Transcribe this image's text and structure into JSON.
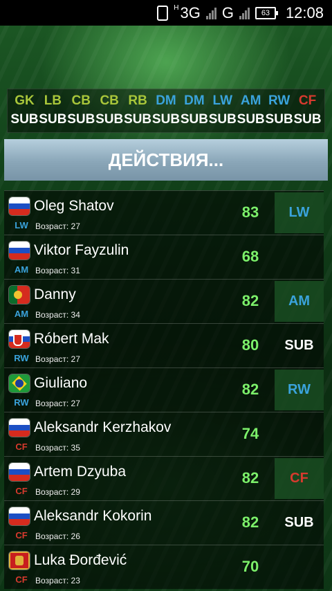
{
  "status_bar": {
    "network_primary": "3G",
    "network_primary_prefix": "H",
    "network_secondary": "G",
    "battery": "63",
    "time": "12:08"
  },
  "positions": [
    {
      "code": "GK",
      "slot": "SUB",
      "color": "#a9c63a"
    },
    {
      "code": "LB",
      "slot": "SUB",
      "color": "#a9c63a"
    },
    {
      "code": "CB",
      "slot": "SUB",
      "color": "#a9c63a"
    },
    {
      "code": "CB",
      "slot": "SUB",
      "color": "#a9c63a"
    },
    {
      "code": "RB",
      "slot": "SUB",
      "color": "#a9c63a"
    },
    {
      "code": "DM",
      "slot": "SUB",
      "color": "#3aa3dc"
    },
    {
      "code": "DM",
      "slot": "SUB",
      "color": "#3aa3dc"
    },
    {
      "code": "LW",
      "slot": "SUB",
      "color": "#3aa3dc"
    },
    {
      "code": "AM",
      "slot": "SUB",
      "color": "#3aa3dc"
    },
    {
      "code": "RW",
      "slot": "SUB",
      "color": "#3aa3dc"
    },
    {
      "code": "CF",
      "slot": "SUB",
      "color": "#d83a2e"
    }
  ],
  "actions_label": "ДЕЙСТВИЯ...",
  "players": [
    {
      "name": "Oleg Shatov",
      "position": "LW",
      "age_text": "Возраст: 27",
      "rating": "83",
      "slot": "LW",
      "flag": "russia-flag-icon"
    },
    {
      "name": "Viktor Fayzulin",
      "position": "AM",
      "age_text": "Возраст: 31",
      "rating": "68",
      "slot": "",
      "flag": "russia-flag-icon"
    },
    {
      "name": "Danny",
      "position": "AM",
      "age_text": "Возраст: 34",
      "rating": "82",
      "slot": "AM",
      "flag": "portugal-flag-icon"
    },
    {
      "name": "Róbert Mak",
      "position": "RW",
      "age_text": "Возраст: 27",
      "rating": "80",
      "slot": "SUB",
      "flag": "slovakia-flag-icon"
    },
    {
      "name": "Giuliano",
      "position": "RW",
      "age_text": "Возраст: 27",
      "rating": "82",
      "slot": "RW",
      "flag": "brazil-flag-icon"
    },
    {
      "name": "Aleksandr Kerzhakov",
      "position": "CF",
      "age_text": "Возраст: 35",
      "rating": "74",
      "slot": "",
      "flag": "russia-flag-icon"
    },
    {
      "name": "Artem Dzyuba",
      "position": "CF",
      "age_text": "Возраст: 29",
      "rating": "82",
      "slot": "CF",
      "flag": "russia-flag-icon"
    },
    {
      "name": "Aleksandr Kokorin",
      "position": "CF",
      "age_text": "Возраст: 26",
      "rating": "82",
      "slot": "SUB",
      "flag": "russia-flag-icon"
    },
    {
      "name": "Luka Đorđević",
      "position": "CF",
      "age_text": "Возраст: 23",
      "rating": "70",
      "slot": "",
      "flag": "montenegro-flag-icon"
    }
  ],
  "colors": {
    "defense": "#a9c63a",
    "midfield_attack": "#3aa3dc",
    "forward": "#d83a2e",
    "rating": "#7cf06a"
  }
}
